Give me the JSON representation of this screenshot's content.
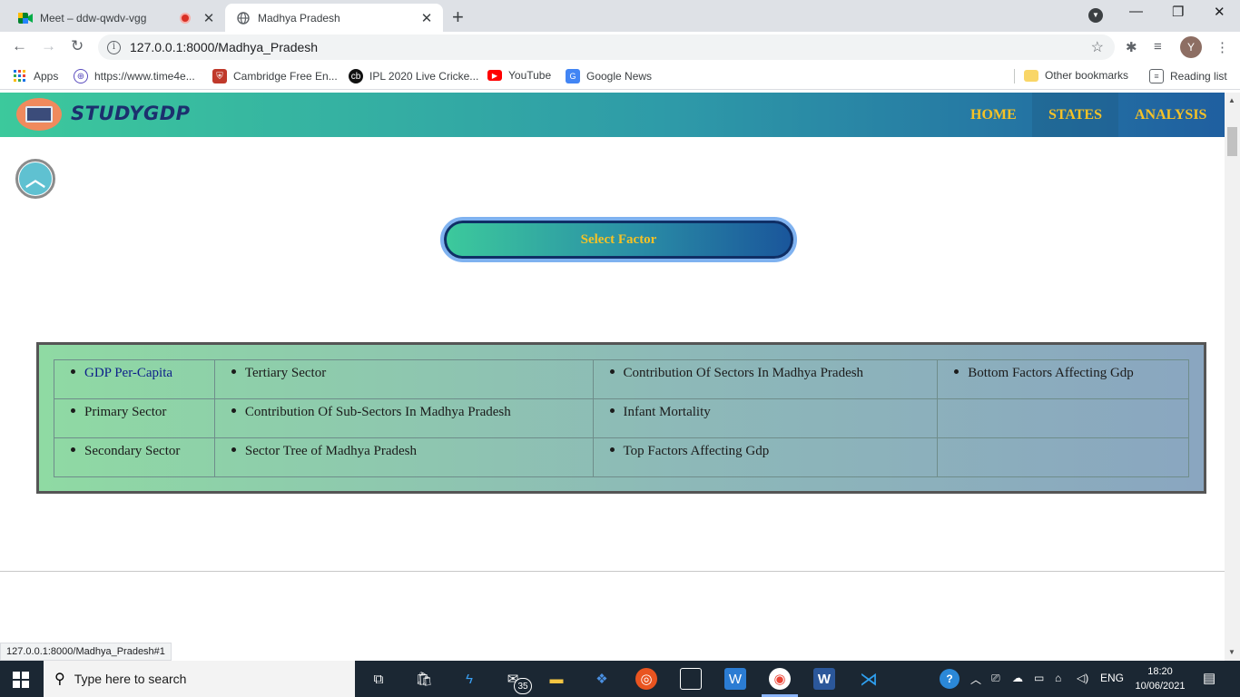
{
  "browser": {
    "tabs": [
      {
        "title": "Meet – ddw-qwdv-vgg",
        "recording": true
      },
      {
        "title": "Madhya Pradesh"
      }
    ],
    "url": "127.0.0.1:8000/Madhya_Pradesh",
    "profile_initial": "Y",
    "bookmarks": [
      "Apps",
      "https://www.time4e...",
      "Cambridge Free En...",
      "IPL 2020 Live Cricke...",
      "YouTube",
      "Google News"
    ],
    "other_bookmarks": "Other bookmarks",
    "reading_list": "Reading list",
    "status_url": "127.0.0.1:8000/Madhya_Pradesh#1"
  },
  "site": {
    "logo": "STUDYGDP",
    "nav": [
      "HOME",
      "STATES",
      "ANALYSIS"
    ],
    "current_nav": "STATES",
    "select_button": "Select Factor",
    "factors": [
      [
        "GDP Per-Capita",
        "Tertiary Sector",
        "Contribution Of Sectors In Madhya Pradesh",
        "Bottom Factors Affecting Gdp"
      ],
      [
        "Primary Sector",
        "Contribution Of Sub-Sectors In Madhya Pradesh",
        "Infant Mortality",
        ""
      ],
      [
        "Secondary Sector",
        "Sector Tree of Madhya Pradesh",
        "Top Factors Affecting Gdp",
        ""
      ]
    ]
  },
  "taskbar": {
    "search_placeholder": "Type here to search",
    "mail_badge": "35",
    "language": "ENG",
    "time": "18:20",
    "date": "10/06/2021"
  },
  "colors": {
    "nav_gradient_start": "#3cc99c",
    "nav_gradient_end": "#1f5fa0",
    "nav_text": "#f5c226",
    "link": "#0d1f8a"
  }
}
